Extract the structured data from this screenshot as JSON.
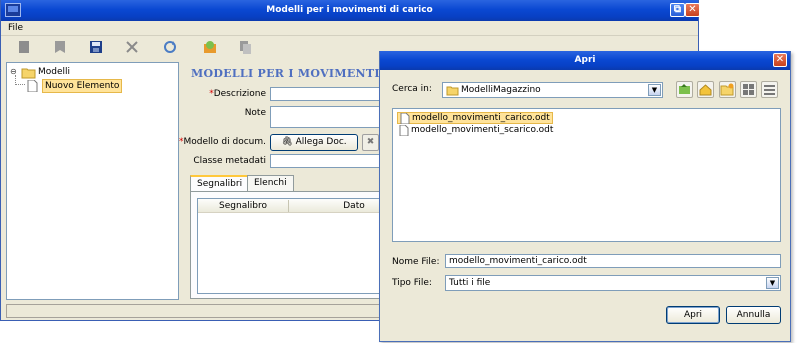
{
  "window": {
    "title": "Modelli per i movimenti di carico",
    "menu": [
      "File"
    ],
    "toolbar_icons": [
      "new-icon",
      "delete-bookmark-icon",
      "save-icon",
      "cancel-icon",
      "refresh-icon",
      "bundle-icon",
      "copy-icon"
    ]
  },
  "tree": {
    "root": "Modelli",
    "child": "Nuovo Elemento"
  },
  "form": {
    "title": "MODELLI PER I MOVIMENTI DI CARICO",
    "descrizione_label": "Descrizione",
    "note_label": "Note",
    "modello_label": "Modello di docum.",
    "allega_button": "Allega Doc.",
    "classe_label": "Classe metadati",
    "tabs": [
      "Segnalibri",
      "Elenchi"
    ],
    "columns": [
      "Segnalibro",
      "Dato"
    ]
  },
  "dialog": {
    "title": "Apri",
    "cerca_label": "Cerca in:",
    "cerca_value": "ModelliMagazzino",
    "files": [
      "modello_movimenti_carico.odt",
      "modello_movimenti_scarico.odt"
    ],
    "nome_file_label": "Nome File:",
    "nome_file_value": "modello_movimenti_carico.odt",
    "tipo_file_label": "Tipo File:",
    "tipo_file_value": "Tutti i file",
    "open_button": "Apri",
    "cancel_button": "Annulla"
  },
  "colors": {
    "titlebar": "#0a48d2",
    "form_title": "#4f6fc0",
    "selection": "#ffe39a",
    "required": "#d40000"
  }
}
